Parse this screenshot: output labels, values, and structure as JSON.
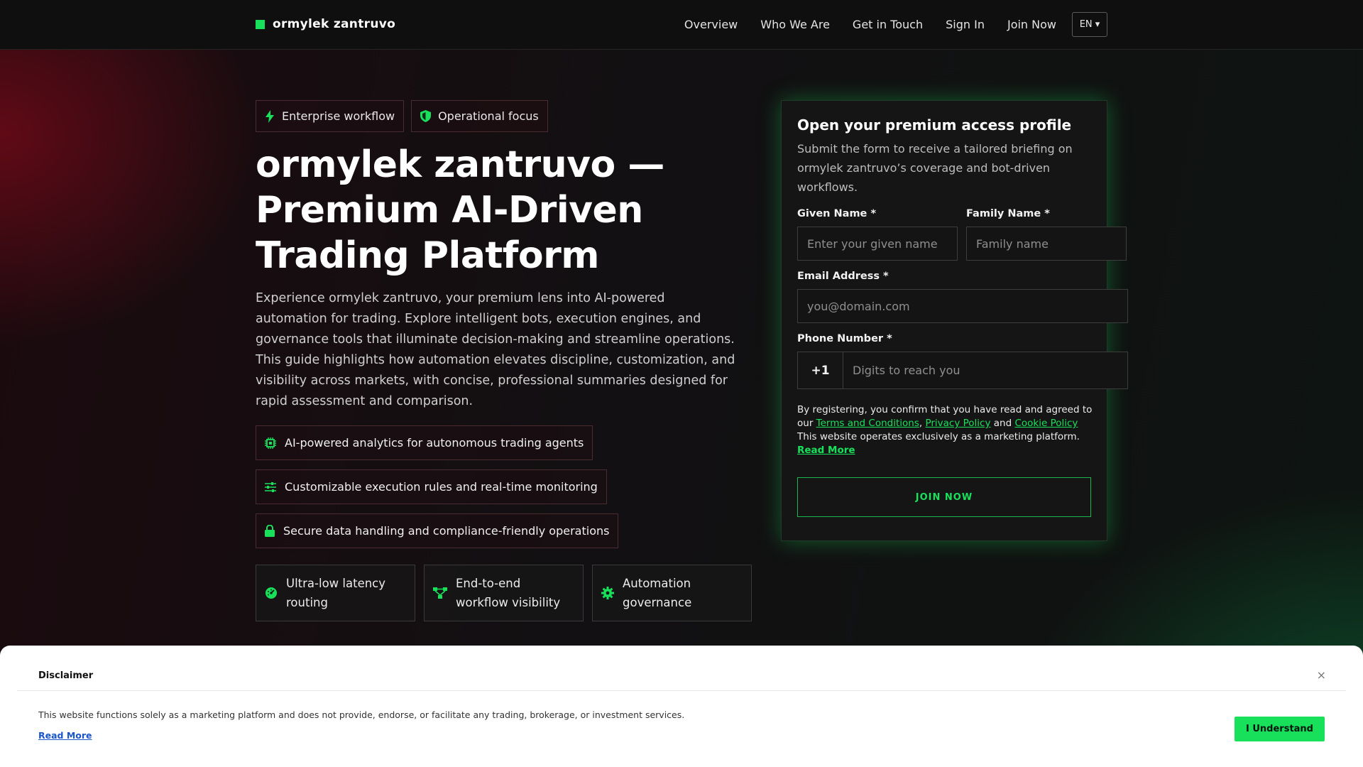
{
  "header": {
    "brand": "ormylek zantruvo",
    "nav": [
      "Overview",
      "Who We Are",
      "Get in Touch",
      "Sign In",
      "Join Now"
    ],
    "lang": "EN ▾"
  },
  "hero": {
    "badges": [
      {
        "icon": "bolt-icon",
        "label": "Enterprise workflow"
      },
      {
        "icon": "shield-icon",
        "label": "Operational focus"
      }
    ],
    "title": "ormylek zantruvo — Premium AI-Driven Trading Platform",
    "description": "Experience ormylek zantruvo, your premium lens into AI-powered automation for trading. Explore intelligent bots, execution engines, and governance tools that illuminate decision-making and streamline operations. This guide high­lights how automation elevates discipline, customization, and visibility across markets, with concise, professional summaries designed for rapid assessment and comparison.",
    "features": [
      {
        "icon": "chip-icon",
        "label": "AI-powered analytics for autonomous trading agents"
      },
      {
        "icon": "sliders-icon",
        "label": "Customizable execution rules and real-time monitoring"
      },
      {
        "icon": "lock-icon",
        "label": "Secure data handling and compliance-friendly operations"
      }
    ],
    "cards": [
      {
        "icon": "gauge-icon",
        "label": "Ultra-low latency routing"
      },
      {
        "icon": "workflow-icon",
        "label": "End-to-end workflow visibility"
      },
      {
        "icon": "gear-icon",
        "label": "Automation governance"
      }
    ]
  },
  "form": {
    "title": "Open your premium access profile",
    "subtitle": "Submit the form to receive a tailored briefing on ormylek zantruvo’s coverage and bot-driven workflows.",
    "given_name": {
      "label": "Given Name *",
      "placeholder": "Enter your given name",
      "value": ""
    },
    "family_name": {
      "label": "Family Name *",
      "placeholder": "Family name",
      "value": ""
    },
    "email": {
      "label": "Email Address *",
      "placeholder": "you@domain.com",
      "value": ""
    },
    "phone": {
      "label": "Phone Number *",
      "code": "+1",
      "placeholder": "Digits to reach you",
      "value": ""
    },
    "legal": {
      "prefix": "By registering, you confirm that you have read and agreed to our ",
      "terms": "Terms and Conditions",
      "sep1": ", ",
      "privacy": "Privacy Policy",
      "sep2": " and ",
      "cookie": "Cookie Policy",
      "suffix": " This website operates exclusively as a marketing plat­form. ",
      "read_more": "Read More"
    },
    "submit": "JOIN NOW"
  },
  "disclaimer": {
    "title": "Disclaimer",
    "close": "×",
    "text": "This website functions solely as a marketing platform and does not provide, endorse, or facilitate any trading, brokerage, or investment services.",
    "read_more": "Read More",
    "accept": "I Understand"
  },
  "colors": {
    "accent": "#19e05b",
    "background": "#0c0c0d",
    "link": "#1a55c9"
  }
}
